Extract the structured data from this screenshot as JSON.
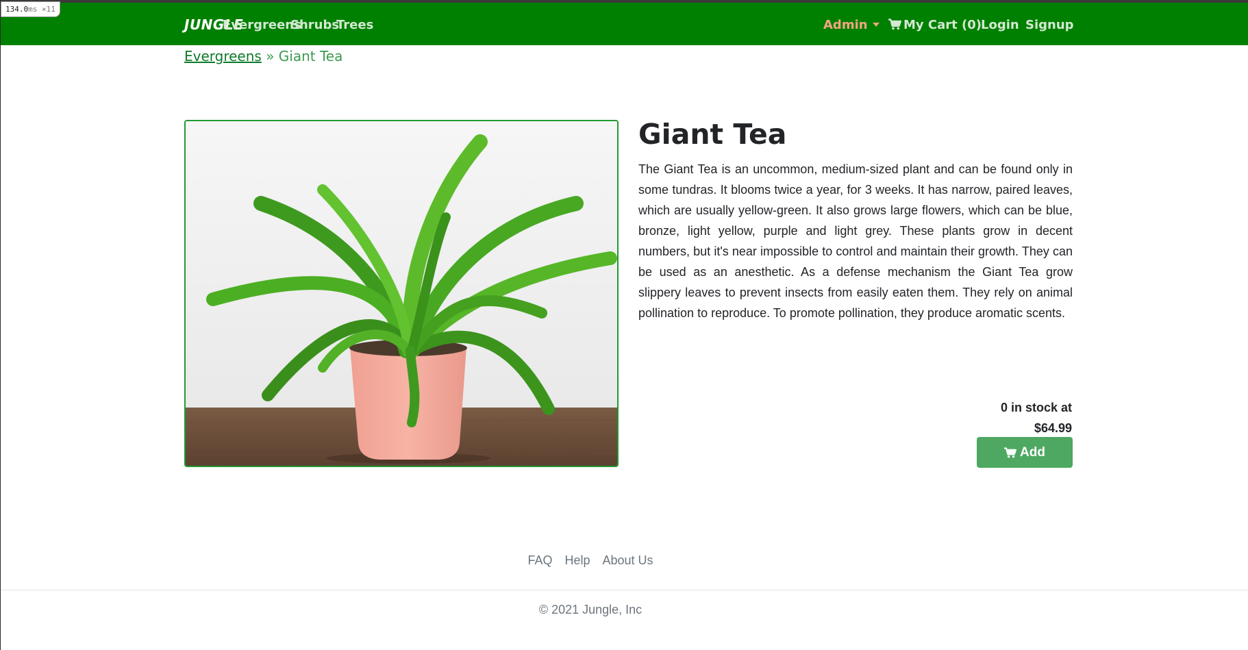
{
  "perf": {
    "value": "134.0",
    "unit": "ms",
    "count": "×11"
  },
  "nav": {
    "brand": "JUNGLE",
    "links": [
      "Evergreens",
      "Shrubs",
      "Trees"
    ],
    "admin": "Admin",
    "cart": "My Cart (0)",
    "login": "Login",
    "signup": "Signup"
  },
  "breadcrumb": {
    "parent": "Evergreens",
    "separator": " » ",
    "current": "Giant Tea"
  },
  "product": {
    "name": "Giant Tea",
    "image_alt": "Potted bird's nest fern in a pink pot",
    "description": "The Giant Tea is an uncommon, medium-sized plant and can be found only in some tundras. It blooms twice a year, for 3 weeks. It has narrow, paired leaves, which are usually yellow-green. It also grows large flowers, which can be blue, bronze, light yellow, purple and light grey. These plants grow in decent numbers, but it's near impossible to control and maintain their growth. They can be used as an anesthetic. As a defense mechanism the Giant Tea grow slippery leaves to prevent insects from easily eaten them. They rely on animal pollination to reproduce. To promote pollination, they produce aromatic scents.",
    "stock_text": "0 in stock at",
    "price": "$64.99",
    "add_label": "Add"
  },
  "footer": {
    "links": [
      "FAQ",
      "Help",
      "About Us"
    ],
    "copyright": "© 2021 Jungle, Inc"
  },
  "colors": {
    "navbar": "#008000",
    "nav_link": "#d4e8d2",
    "admin": "#f4a582",
    "button": "#4ea861",
    "image_border": "#1f9b34"
  },
  "icons": {
    "cart": "shopping-cart-icon",
    "admin_caret": "caret-down-icon"
  }
}
